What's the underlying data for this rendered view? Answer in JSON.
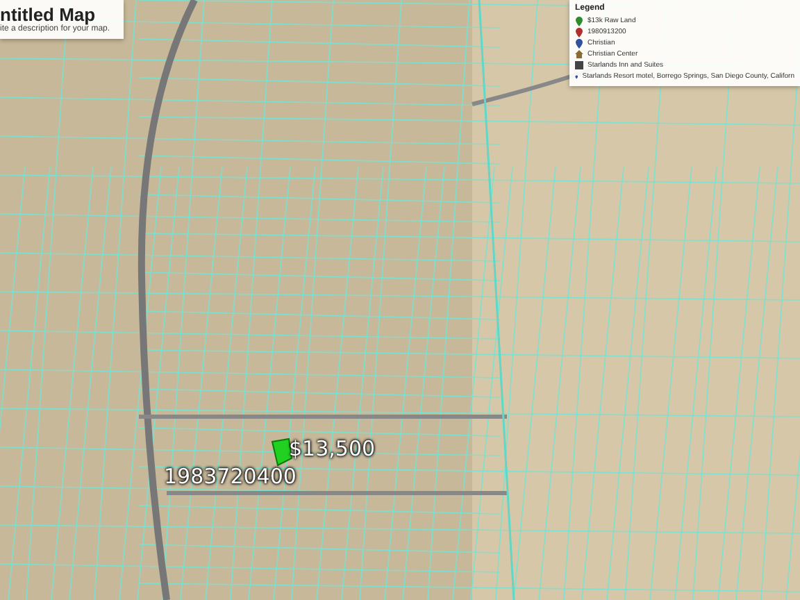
{
  "map_header": {
    "title": "ntitled Map",
    "description": "ite a description for your map."
  },
  "legend": {
    "title": "Legend",
    "items": [
      {
        "kind": "pin",
        "color": "#2e8b2e",
        "label": "$13k Raw Land"
      },
      {
        "kind": "pin",
        "color": "#b03030",
        "label": "1980913200"
      },
      {
        "kind": "pin",
        "color": "#3050a0",
        "label": "Christian"
      },
      {
        "kind": "home",
        "color": "#8a6a30",
        "label": "Christian Center"
      },
      {
        "kind": "building",
        "color": "#444444",
        "label": "Starlands Inn and Suites"
      },
      {
        "kind": "pin",
        "color": "#3050a0",
        "label": "Starlands Resort motel, Borrego Springs, San Diego County, Californ"
      }
    ]
  },
  "map_labels": [
    {
      "text": "$13,500"
    },
    {
      "text": "1983720400"
    }
  ]
}
